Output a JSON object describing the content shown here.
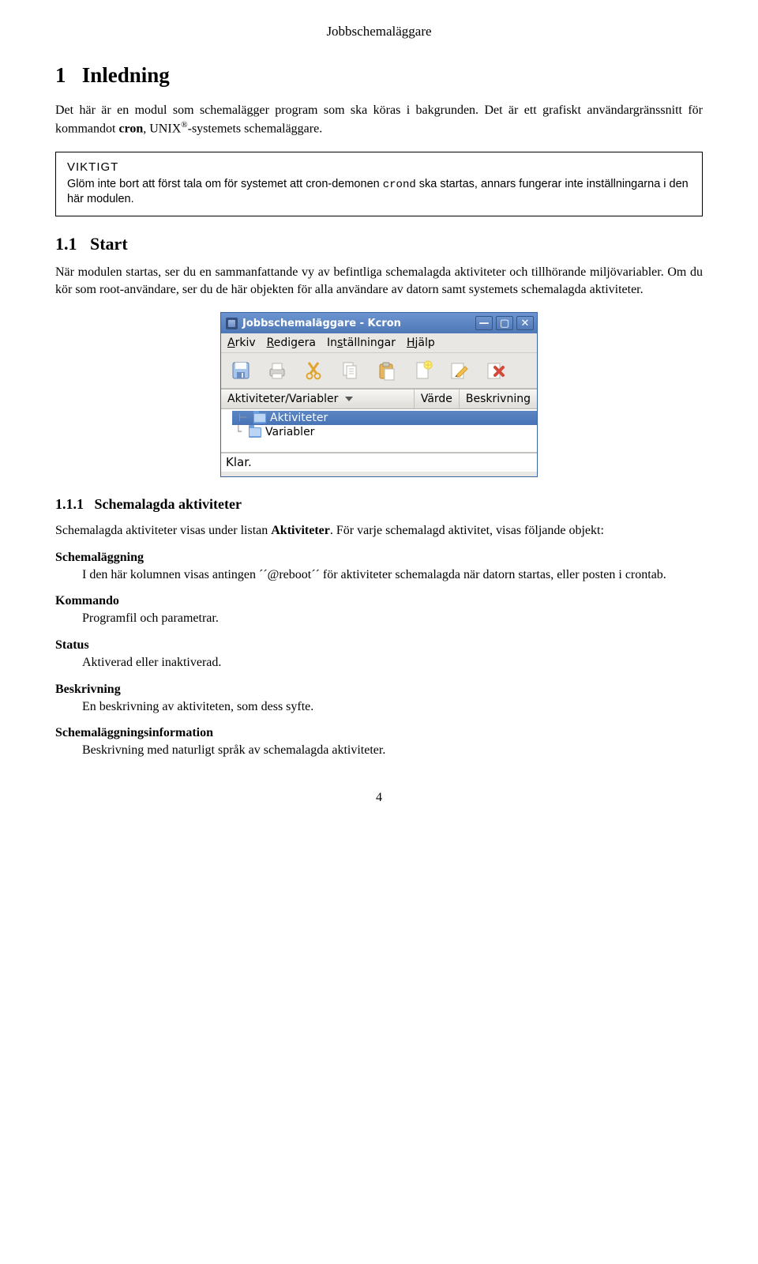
{
  "header": {
    "title": "Jobbschemaläggare"
  },
  "h1": {
    "num": "1",
    "title": "Inledning"
  },
  "intro": {
    "p1a": "Det här är en modul som schemalägger program som ska köras i bakgrunden. Det är ett grafiskt användargränssnitt för kommandot ",
    "cron": "cron",
    "p1b": ", UNIX",
    "reg": "®",
    "p1c": "-systemets schemaläggare."
  },
  "viktigt": {
    "title": "VIKTIGT",
    "body_a": "Glöm inte bort att först tala om för systemet att cron-demonen ",
    "crond": "crond",
    "body_b": " ska startas, annars fungerar inte inställningarna i den här modulen."
  },
  "h2": {
    "num": "1.1",
    "title": "Start"
  },
  "start": {
    "p": "När modulen startas, ser du en sammanfattande vy av befintliga schemalagda aktiviteter och tillhörande miljövariabler. Om du kör som root-användare, ser du de här objekten för alla användare av datorn samt systemets schemalagda aktiviteter."
  },
  "window": {
    "title": "Jobbschemaläggare - Kcron",
    "min": "—",
    "max": "▢",
    "close": "✕",
    "menu": {
      "arkiv": "Arkiv",
      "redigera": "Redigera",
      "installningar": "Inställningar",
      "hjalp": "Hjälp"
    },
    "columns": {
      "c1": "Aktiviteter/Variabler",
      "c2": "Värde",
      "c3": "Beskrivning"
    },
    "tree": {
      "item1": "Aktiviteter",
      "item2": "Variabler"
    },
    "status": "Klar."
  },
  "h3": {
    "num": "1.1.1",
    "title": "Schemalagda aktiviteter"
  },
  "sched": {
    "p_a": "Schemalagda aktiviteter visas under listan ",
    "p_bold": "Aktiviteter",
    "p_b": ". För varje schemalagd aktivitet, visas följande objekt:"
  },
  "defs": {
    "d1t": "Schemaläggning",
    "d1d": "I den här kolumnen visas antingen ´´@reboot´´ för aktiviteter schemalagda när datorn startas, eller posten i crontab.",
    "d2t": "Kommando",
    "d2d": "Programfil och parametrar.",
    "d3t": "Status",
    "d3d": "Aktiverad eller inaktiverad.",
    "d4t": "Beskrivning",
    "d4d": "En beskrivning av aktiviteten, som dess syfte.",
    "d5t": "Schemaläggningsinformation",
    "d5d": "Beskrivning med naturligt språk av schemalagda aktiviteter."
  },
  "pagenum": "4"
}
